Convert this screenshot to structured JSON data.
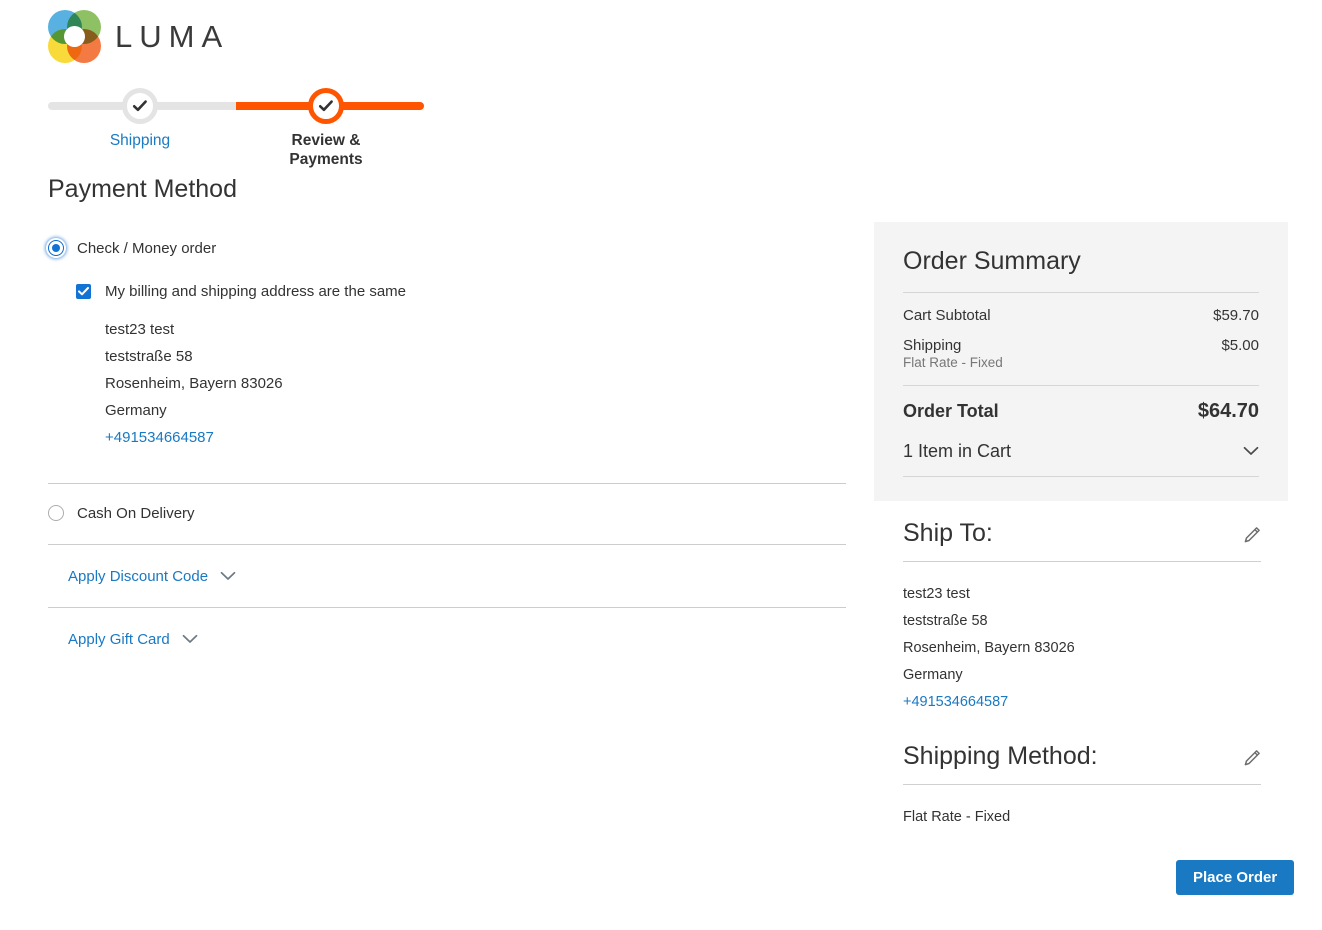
{
  "brand": {
    "name": "LUMA",
    "logo_icon": "luma-rings-logo"
  },
  "progress": {
    "steps": [
      {
        "label": "Shipping",
        "state": "completed",
        "icon": "check-icon"
      },
      {
        "label": "Review & Payments",
        "state": "active",
        "icon": "check-icon"
      }
    ]
  },
  "payment": {
    "heading": "Payment Method",
    "methods": [
      {
        "label": "Check / Money order",
        "selected": true
      },
      {
        "label": "Cash On Delivery",
        "selected": false
      }
    ],
    "billing_same_label": "My billing and shipping address are the same",
    "billing_same_checked": true,
    "billing_address": {
      "name": "test23 test",
      "street": "teststraße 58",
      "city_region_zip": "Rosenheim, Bayern 83026",
      "country": "Germany",
      "phone": "+491534664587"
    },
    "discount_label": "Apply Discount Code",
    "giftcard_label": "Apply Gift Card"
  },
  "summary": {
    "title": "Order Summary",
    "rows": [
      {
        "label": "Cart Subtotal",
        "value": "$59.70",
        "note": ""
      },
      {
        "label": "Shipping",
        "value": "$5.00",
        "note": "Flat Rate - Fixed"
      }
    ],
    "total_label": "Order Total",
    "total_value": "$64.70",
    "items_label": "1 Item in Cart"
  },
  "ship_to": {
    "title": "Ship To:",
    "edit_icon": "pencil-icon",
    "address": {
      "name": "test23 test",
      "street": "teststraße 58",
      "city_region_zip": "Rosenheim, Bayern 83026",
      "country": "Germany",
      "phone": "+491534664587"
    }
  },
  "shipping_method": {
    "title": "Shipping Method:",
    "edit_icon": "pencil-icon",
    "value": "Flat Rate - Fixed"
  },
  "actions": {
    "place_order_label": "Place Order"
  },
  "colors": {
    "accent_orange": "#ff5501",
    "link_blue": "#1979c3",
    "button_blue": "#1979c3",
    "panel_gray": "#f4f4f4"
  }
}
